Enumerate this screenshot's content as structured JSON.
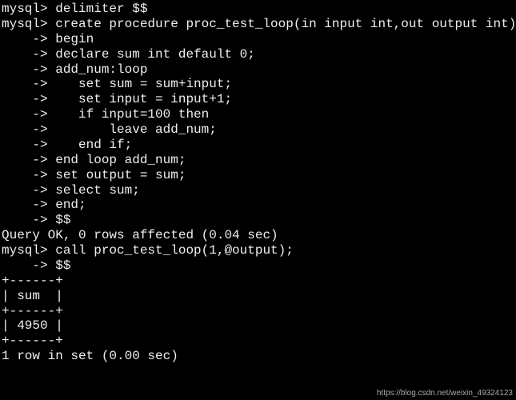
{
  "lines": [
    {
      "prompt": "mysql>",
      "text": " delimiter $$"
    },
    {
      "prompt": "mysql>",
      "text": " create procedure proc_test_loop(in input int,out output int)"
    },
    {
      "prompt": "    ->",
      "text": " begin"
    },
    {
      "prompt": "    ->",
      "text": " declare sum int default 0;"
    },
    {
      "prompt": "    ->",
      "text": " add_num:loop"
    },
    {
      "prompt": "    ->",
      "text": "    set sum = sum+input;"
    },
    {
      "prompt": "    ->",
      "text": "    set input = input+1;"
    },
    {
      "prompt": "    ->",
      "text": "    if input=100 then"
    },
    {
      "prompt": "    ->",
      "text": "        leave add_num;"
    },
    {
      "prompt": "    ->",
      "text": "    end if;"
    },
    {
      "prompt": "    ->",
      "text": " end loop add_num;"
    },
    {
      "prompt": "    ->",
      "text": " set output = sum;"
    },
    {
      "prompt": "    ->",
      "text": " select sum;"
    },
    {
      "prompt": "    ->",
      "text": " end;"
    },
    {
      "prompt": "    ->",
      "text": " $$"
    },
    {
      "prompt": "",
      "text": "Query OK, 0 rows affected (0.04 sec)"
    },
    {
      "prompt": "",
      "text": ""
    },
    {
      "prompt": "mysql>",
      "text": " call proc_test_loop(1,@output);"
    },
    {
      "prompt": "    ->",
      "text": " $$"
    },
    {
      "prompt": "",
      "text": "+------+"
    },
    {
      "prompt": "",
      "text": "| sum  |"
    },
    {
      "prompt": "",
      "text": "+------+"
    },
    {
      "prompt": "",
      "text": "| 4950 |"
    },
    {
      "prompt": "",
      "text": "+------+"
    },
    {
      "prompt": "",
      "text": "1 row in set (0.00 sec)"
    }
  ],
  "watermark": "https://blog.csdn.net/weixin_49324123",
  "result_table": {
    "columns": [
      "sum"
    ],
    "rows": [
      [
        4950
      ]
    ]
  },
  "query_status": {
    "create": "Query OK, 0 rows affected (0.04 sec)",
    "select": "1 row in set (0.00 sec)"
  }
}
